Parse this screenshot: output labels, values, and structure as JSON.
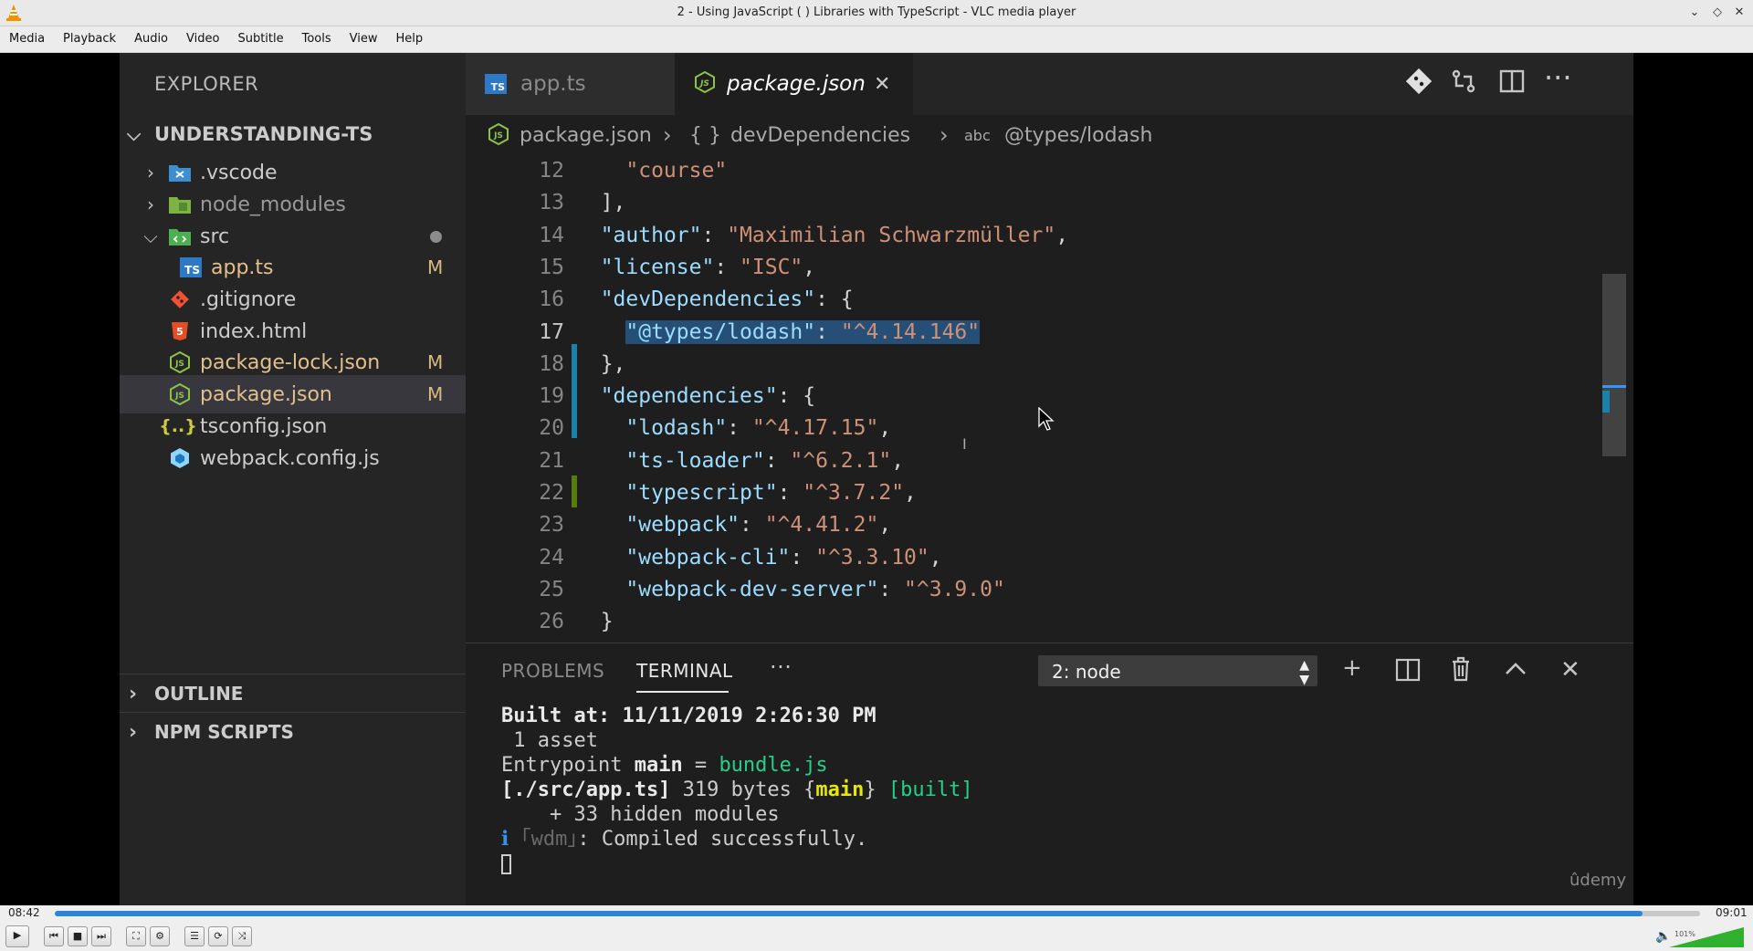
{
  "window": {
    "title": "2 - Using JavaScript ( ) Libraries with TypeScript - VLC media player"
  },
  "menu": [
    "Media",
    "Playback",
    "Audio",
    "Video",
    "Subtitle",
    "Tools",
    "View",
    "Help"
  ],
  "vscode": {
    "explorer_title": "EXPLORER",
    "root_folder": "UNDERSTANDING-TS",
    "tree": [
      {
        "label": ".vscode",
        "badge": ""
      },
      {
        "label": "node_modules",
        "badge": ""
      },
      {
        "label": "src",
        "badge": ""
      },
      {
        "label": "app.ts",
        "badge": "M"
      },
      {
        "label": ".gitignore",
        "badge": ""
      },
      {
        "label": "index.html",
        "badge": ""
      },
      {
        "label": "package-lock.json",
        "badge": "M"
      },
      {
        "label": "package.json",
        "badge": "M"
      },
      {
        "label": "tsconfig.json",
        "badge": ""
      },
      {
        "label": "webpack.config.js",
        "badge": ""
      }
    ],
    "outline_label": "OUTLINE",
    "npm_scripts_label": "NPM SCRIPTS",
    "tabs": [
      {
        "label": "app.ts",
        "icon_text": "TS"
      },
      {
        "label": "package.json",
        "icon_text": "JS"
      }
    ],
    "breadcrumb": [
      "package.json",
      "devDependencies",
      "@types/lodash"
    ],
    "code_lines": [
      {
        "n": "12",
        "text": "    \"course\""
      },
      {
        "n": "13",
        "text": "  ],"
      },
      {
        "n": "14",
        "key": "author",
        "value": "Maximilian Schwarzmüller",
        "trail": ","
      },
      {
        "n": "15",
        "key": "license",
        "value": "ISC",
        "trail": ","
      },
      {
        "n": "16",
        "key": "devDependencies",
        "open": ": {"
      },
      {
        "n": "17",
        "key": "@types/lodash",
        "value": "^4.14.146",
        "selected": true
      },
      {
        "n": "18",
        "text": "  },"
      },
      {
        "n": "19",
        "key": "dependencies",
        "open": ": {"
      },
      {
        "n": "20",
        "key": "lodash",
        "value": "^4.17.15",
        "trail": ",",
        "indent": true
      },
      {
        "n": "21",
        "key": "ts-loader",
        "value": "^6.2.1",
        "trail": ",",
        "indent": true
      },
      {
        "n": "22",
        "key": "typescript",
        "value": "^3.7.2",
        "trail": ",",
        "indent": true
      },
      {
        "n": "23",
        "key": "webpack",
        "value": "^4.41.2",
        "trail": ",",
        "indent": true
      },
      {
        "n": "24",
        "key": "webpack-cli",
        "value": "^3.3.10",
        "trail": ",",
        "indent": true
      },
      {
        "n": "25",
        "key": "webpack-dev-server",
        "value": "^3.9.0",
        "trail": "",
        "indent": true
      },
      {
        "n": "26",
        "text": "  }"
      }
    ],
    "panel": {
      "problems_label": "PROBLEMS",
      "terminal_label": "TERMINAL",
      "more_label": "···",
      "terminal_select": "2: node",
      "terminal": {
        "built_at_label": "Built at: 11/11/2019 ",
        "built_at_time": "2:26:30 PM",
        "assets": " 1 asset",
        "entry_prefix": "Entrypoint ",
        "entry_main": "main",
        "entry_eq": " = ",
        "entry_bundle": "bundle.js",
        "app_path": "[./src/app.ts]",
        "app_size": " 319 bytes {",
        "app_main": "main",
        "app_close": "} ",
        "app_built": "[built]",
        "hidden": "    + 33 hidden modules",
        "wdm_i": "ℹ ",
        "wdm": "｢wdm｣",
        "compiled": ": Compiled successfully."
      }
    },
    "watermark": "ûdemy"
  },
  "player": {
    "elapsed": "08:42",
    "total": "09:01",
    "progress_fraction": 0.965,
    "volume_percent": "101%",
    "volume_fraction": 1.0
  }
}
